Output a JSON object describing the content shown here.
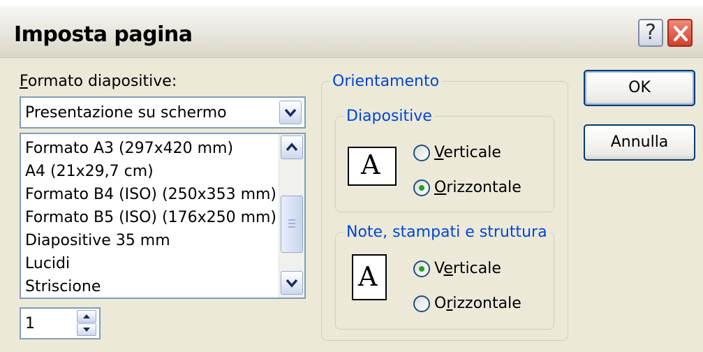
{
  "window": {
    "title": "Imposta pagina"
  },
  "titlebar": {
    "help": "?",
    "close_icon": "close-icon"
  },
  "format": {
    "label_accel": "F",
    "label_rest": "ormato diapositive:",
    "selected": "Presentazione su schermo",
    "options": [
      "Formato A3 (297x420 mm)",
      "A4 (21x29,7 cm)",
      "Formato B4 (ISO) (250x353 mm)",
      "Formato B5 (ISO) (176x250 mm)",
      "Diapositive 35 mm",
      "Lucidi",
      "Striscione"
    ]
  },
  "start_number": {
    "value": "1"
  },
  "orientation": {
    "group_label": "Orientamento",
    "slides": {
      "label": "Diapositive",
      "page_glyph": "A",
      "vertical": {
        "pre": "",
        "accel": "V",
        "post": "erticale",
        "checked": false
      },
      "horizontal": {
        "pre": "",
        "accel": "O",
        "post": "rizzontale",
        "checked": true
      }
    },
    "notes": {
      "label": "Note, stampati e struttura",
      "page_glyph": "A",
      "vertical": {
        "pre": "V",
        "accel": "e",
        "post": "rticale",
        "checked": true
      },
      "horizontal": {
        "pre": "O",
        "accel": "r",
        "post": "izzontale",
        "checked": false
      }
    }
  },
  "buttons": {
    "ok": "OK",
    "cancel": "Annulla"
  },
  "colors": {
    "dialog_bg": "#ECE9D8",
    "group_label": "#0046d5",
    "radio_dot": "#21a121",
    "close_red": "#d2412c"
  }
}
